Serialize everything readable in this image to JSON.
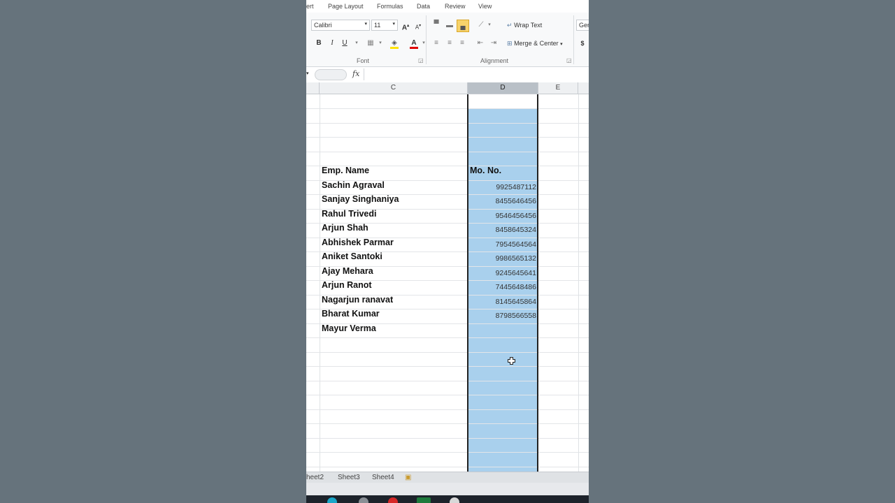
{
  "ribbon": {
    "tabs": [
      "ert",
      "Page Layout",
      "Formulas",
      "Data",
      "Review",
      "View"
    ],
    "font_name": "Calibri",
    "font_size": "11",
    "bold_label": "B",
    "italic_label": "I",
    "underline_label": "U",
    "font_group": "Font",
    "alignment_group": "Alignment",
    "wrap_text": "Wrap Text",
    "merge_center": "Merge & Center",
    "number_format": "Gen",
    "currency": "$",
    "grow_font": "A",
    "shrink_font": "A",
    "font_color_glyph": "A"
  },
  "formula_bar": {
    "fx": "fx",
    "value": ""
  },
  "columns": [
    "C",
    "D",
    "E"
  ],
  "table": {
    "header_name": "Emp. Name",
    "header_mobile": "Mo. No.",
    "rows": [
      {
        "name": "Sachin Agraval",
        "mobile": "9925487112"
      },
      {
        "name": "Sanjay Singhaniya",
        "mobile": "8455646456"
      },
      {
        "name": "Rahul Trivedi",
        "mobile": "9546456456"
      },
      {
        "name": "Arjun Shah",
        "mobile": "8458645324"
      },
      {
        "name": "Abhishek Parmar",
        "mobile": "7954564564"
      },
      {
        "name": "Aniket Santoki",
        "mobile": "9986565132"
      },
      {
        "name": "Ajay Mehara",
        "mobile": "9245645641"
      },
      {
        "name": "Arjun Ranot",
        "mobile": "7445648486"
      },
      {
        "name": "Nagarjun ranavat",
        "mobile": "8145645864"
      },
      {
        "name": "Bharat Kumar",
        "mobile": "8798566558"
      },
      {
        "name": "Mayur Verma",
        "mobile": ""
      }
    ]
  },
  "sheets": [
    "heet2",
    "Sheet3",
    "Sheet4"
  ],
  "colors": {
    "selection": "#a9d0ed",
    "background": "#66737c",
    "highlight_button": "#f7d36b"
  }
}
